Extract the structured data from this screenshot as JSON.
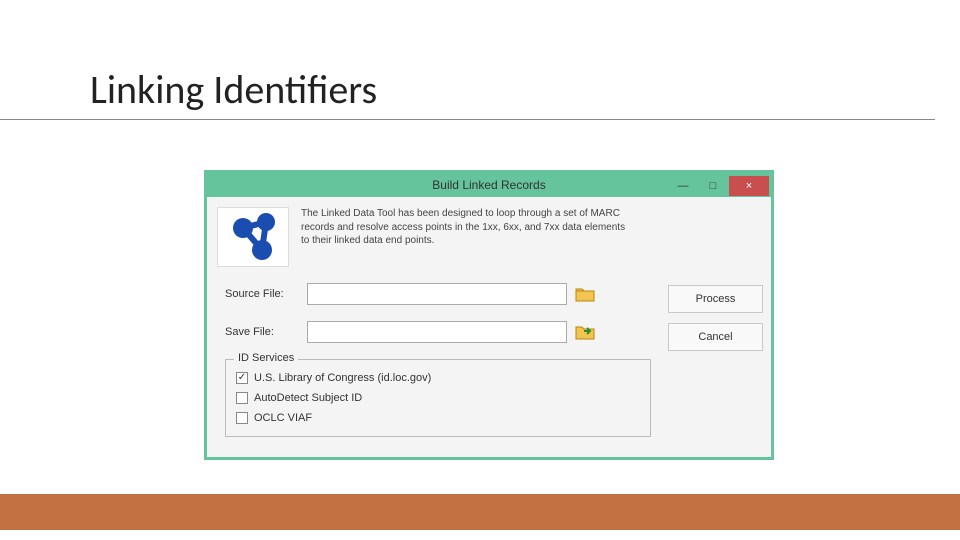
{
  "slide": {
    "title": "Linking Identifiers"
  },
  "window": {
    "title": "Build Linked Records",
    "controls": {
      "min": "—",
      "max": "□",
      "close": "×"
    },
    "description": "The Linked Data Tool has been designed to loop through a set of MARC records and resolve access points in the 1xx, 6xx, and 7xx data elements to their linked data end points.",
    "source_label": "Source File:",
    "source_value": "",
    "save_label": "Save File:",
    "save_value": "",
    "process": "Process",
    "cancel": "Cancel",
    "services_legend": "ID Services",
    "services": [
      {
        "label": "U.S. Library of Congress (id.loc.gov)",
        "checked": true
      },
      {
        "label": "AutoDetect Subject ID",
        "checked": false
      },
      {
        "label": "OCLC VIAF",
        "checked": false
      }
    ]
  }
}
